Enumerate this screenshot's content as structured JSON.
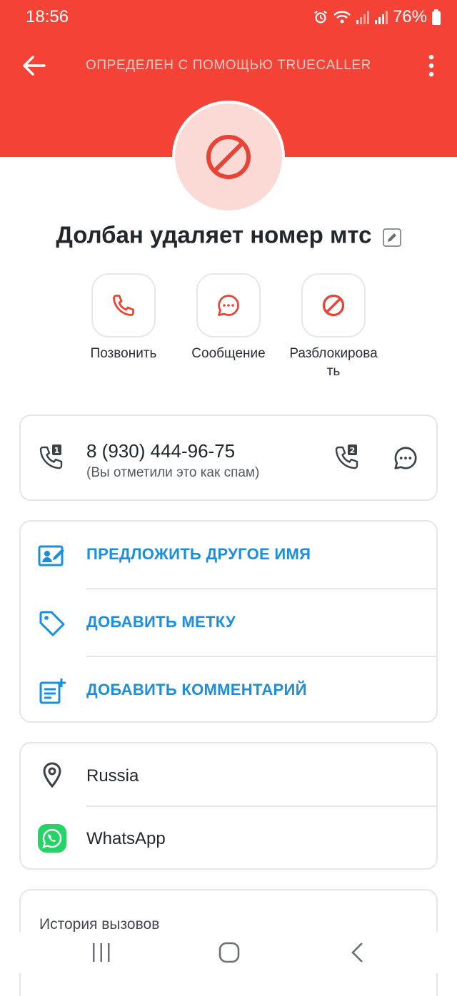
{
  "status_bar": {
    "time": "18:56",
    "battery": "76%",
    "icons": [
      "alarm-icon",
      "wifi-icon",
      "signal-icon",
      "signal-icon",
      "battery-icon"
    ]
  },
  "app_bar": {
    "title": "ОПРЕДЕЛЕН С ПОМОЩЬЮ TRUECALLER",
    "back_icon": "arrow-left-icon",
    "more_icon": "more-vertical-icon"
  },
  "contact": {
    "name": "Долбан удаляет номер мтс",
    "avatar_icon": "block-icon"
  },
  "actions": [
    {
      "label": "Позвонить",
      "icon": "phone-icon"
    },
    {
      "label": "Сообщение",
      "icon": "message-icon"
    },
    {
      "label": "Разблокирова\nть",
      "icon": "block-icon"
    }
  ],
  "phone": {
    "number": "8 (930) 444-96-75",
    "note": "(Вы отметили это как спам)",
    "sim1_badge": "1",
    "sim2_badge": "2"
  },
  "links": [
    {
      "label": "ПРЕДЛОЖИТЬ ДРУГОЕ ИМЯ",
      "icon": "suggest-name-icon"
    },
    {
      "label": "ДОБАВИТЬ МЕТКУ",
      "icon": "tag-icon"
    },
    {
      "label": "ДОБАВИТЬ КОММЕНТАРИЙ",
      "icon": "add-comment-icon"
    }
  ],
  "info": [
    {
      "label": "Russia",
      "icon": "location-icon"
    },
    {
      "label": "WhatsApp",
      "icon": "whatsapp-icon"
    }
  ],
  "history": {
    "title": "История вызовов"
  },
  "colors": {
    "header": "#f44336",
    "accent_red": "#e84335",
    "link_blue": "#1a8fe0",
    "whatsapp_green": "#25d366"
  }
}
